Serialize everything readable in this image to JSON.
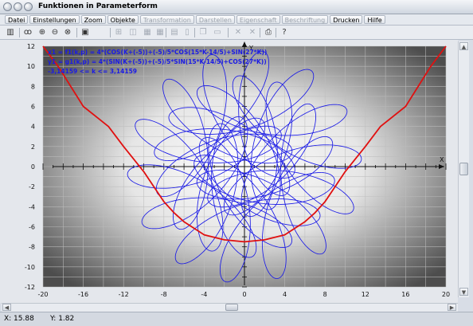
{
  "window": {
    "title": "Funktionen in Parameterform"
  },
  "menu": [
    {
      "label": "Datei",
      "enabled": true
    },
    {
      "label": "Einstellungen",
      "enabled": true
    },
    {
      "label": "Zoom",
      "enabled": true
    },
    {
      "label": "Objekte",
      "enabled": true
    },
    {
      "label": "Transformation",
      "enabled": false
    },
    {
      "label": "Darstellen",
      "enabled": false
    },
    {
      "label": "Eigenschaft",
      "enabled": false
    },
    {
      "label": "Beschriftung",
      "enabled": false
    },
    {
      "label": "Drucken",
      "enabled": true
    },
    {
      "label": "Hilfe",
      "enabled": true
    }
  ],
  "toolbar": [
    {
      "icon": "calculator-icon",
      "glyph": "▥",
      "enabled": true
    },
    {
      "icon": "glasses-icon",
      "glyph": "ꝏ",
      "enabled": true
    },
    {
      "icon": "zoom-in-icon",
      "glyph": "⊕",
      "enabled": true
    },
    {
      "icon": "zoom-out-icon",
      "glyph": "⊖",
      "enabled": true
    },
    {
      "icon": "zoom-reset-icon",
      "glyph": "⊗",
      "enabled": true
    },
    {
      "icon": "window-icon",
      "glyph": "▣",
      "enabled": true
    },
    {
      "icon": "tile-icon",
      "glyph": "⊞",
      "enabled": false
    },
    {
      "icon": "frame-icon",
      "glyph": "◫",
      "enabled": false
    },
    {
      "icon": "grid-icon",
      "glyph": "▦",
      "enabled": false
    },
    {
      "icon": "grid-2-icon",
      "glyph": "▦",
      "enabled": false
    },
    {
      "icon": "table-icon",
      "glyph": "▤",
      "enabled": false
    },
    {
      "icon": "document-icon",
      "glyph": "▯",
      "enabled": false
    },
    {
      "icon": "copy-icon",
      "glyph": "❐",
      "enabled": false
    },
    {
      "icon": "paste-icon",
      "glyph": "▭",
      "enabled": false
    },
    {
      "icon": "cut-icon",
      "glyph": "✕",
      "enabled": false
    },
    {
      "icon": "delete-icon",
      "glyph": "✕",
      "enabled": false
    },
    {
      "icon": "print-icon",
      "glyph": "⎙",
      "enabled": true
    },
    {
      "icon": "help-icon",
      "glyph": "?",
      "enabled": true
    }
  ],
  "chart_data": {
    "type": "line",
    "xlim": [
      -20,
      20
    ],
    "ylim": [
      -12,
      12
    ],
    "xlabel": "X",
    "ylabel": "Y",
    "x_ticks": [
      -20,
      -16,
      -12,
      -8,
      -4,
      0,
      4,
      8,
      12,
      16,
      20
    ],
    "y_ticks": [
      -12,
      -10,
      -8,
      -6,
      -4,
      -2,
      0,
      2,
      4,
      6,
      8,
      10,
      12
    ],
    "grid": true,
    "annotations": [
      "x1 = f1(k,p) = 4*(COS(K+(-5))+(-5)/5*COS(15*K-14/5)+SIN(27*K))",
      "y1 = g1(k,p) = 4*(SIN(K+(-5))+(-5)/5*SIN(15*K-14/5)+COS(27*K))",
      "-3,14159 <= k <= 3,14159"
    ],
    "series": [
      {
        "color": "#1a1ae6",
        "k_range": [
          -3.14159,
          3.14159
        ]
      },
      {
        "color": "#e01010"
      }
    ],
    "red_curve_points": [
      [
        -20,
        12
      ],
      [
        -18.5,
        10
      ],
      [
        -16,
        6
      ],
      [
        -13.5,
        4
      ],
      [
        -12,
        2
      ],
      [
        -10,
        -0.5
      ],
      [
        -9,
        -2
      ],
      [
        -8,
        -3.5
      ],
      [
        -7,
        -4.6
      ],
      [
        -6,
        -5.5
      ],
      [
        -4,
        -6.8
      ],
      [
        -2,
        -7.3
      ],
      [
        0,
        -7.5
      ],
      [
        2,
        -7.3
      ],
      [
        4,
        -6.8
      ],
      [
        6,
        -5.5
      ],
      [
        7,
        -4.6
      ],
      [
        8,
        -3.5
      ],
      [
        9,
        -2
      ],
      [
        10,
        -0.5
      ],
      [
        12,
        2
      ],
      [
        13.5,
        4
      ],
      [
        16,
        6
      ],
      [
        18.5,
        10
      ],
      [
        20,
        12
      ]
    ]
  },
  "status": {
    "x_value": "X: 15.88",
    "y_value": "Y: 1.82"
  }
}
